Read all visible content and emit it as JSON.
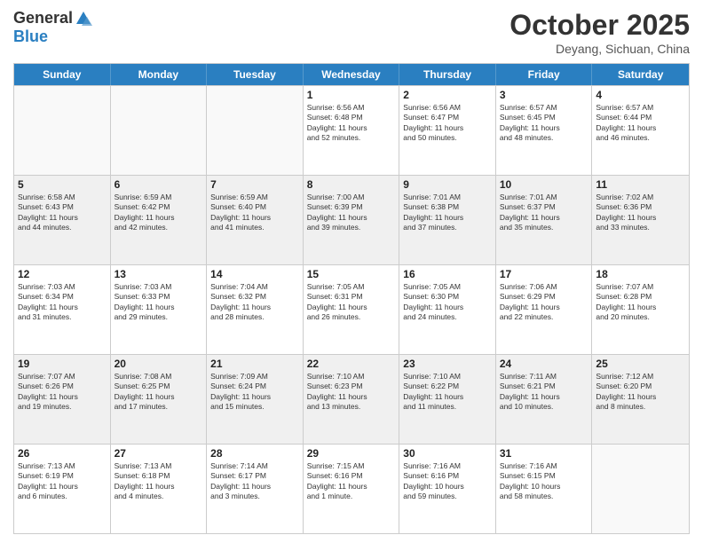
{
  "header": {
    "logo_general": "General",
    "logo_blue": "Blue",
    "month_title": "October 2025",
    "subtitle": "Deyang, Sichuan, China"
  },
  "days_of_week": [
    "Sunday",
    "Monday",
    "Tuesday",
    "Wednesday",
    "Thursday",
    "Friday",
    "Saturday"
  ],
  "weeks": [
    [
      {
        "day": "",
        "lines": []
      },
      {
        "day": "",
        "lines": []
      },
      {
        "day": "",
        "lines": []
      },
      {
        "day": "1",
        "lines": [
          "Sunrise: 6:56 AM",
          "Sunset: 6:48 PM",
          "Daylight: 11 hours",
          "and 52 minutes."
        ]
      },
      {
        "day": "2",
        "lines": [
          "Sunrise: 6:56 AM",
          "Sunset: 6:47 PM",
          "Daylight: 11 hours",
          "and 50 minutes."
        ]
      },
      {
        "day": "3",
        "lines": [
          "Sunrise: 6:57 AM",
          "Sunset: 6:45 PM",
          "Daylight: 11 hours",
          "and 48 minutes."
        ]
      },
      {
        "day": "4",
        "lines": [
          "Sunrise: 6:57 AM",
          "Sunset: 6:44 PM",
          "Daylight: 11 hours",
          "and 46 minutes."
        ]
      }
    ],
    [
      {
        "day": "5",
        "lines": [
          "Sunrise: 6:58 AM",
          "Sunset: 6:43 PM",
          "Daylight: 11 hours",
          "and 44 minutes."
        ]
      },
      {
        "day": "6",
        "lines": [
          "Sunrise: 6:59 AM",
          "Sunset: 6:42 PM",
          "Daylight: 11 hours",
          "and 42 minutes."
        ]
      },
      {
        "day": "7",
        "lines": [
          "Sunrise: 6:59 AM",
          "Sunset: 6:40 PM",
          "Daylight: 11 hours",
          "and 41 minutes."
        ]
      },
      {
        "day": "8",
        "lines": [
          "Sunrise: 7:00 AM",
          "Sunset: 6:39 PM",
          "Daylight: 11 hours",
          "and 39 minutes."
        ]
      },
      {
        "day": "9",
        "lines": [
          "Sunrise: 7:01 AM",
          "Sunset: 6:38 PM",
          "Daylight: 11 hours",
          "and 37 minutes."
        ]
      },
      {
        "day": "10",
        "lines": [
          "Sunrise: 7:01 AM",
          "Sunset: 6:37 PM",
          "Daylight: 11 hours",
          "and 35 minutes."
        ]
      },
      {
        "day": "11",
        "lines": [
          "Sunrise: 7:02 AM",
          "Sunset: 6:36 PM",
          "Daylight: 11 hours",
          "and 33 minutes."
        ]
      }
    ],
    [
      {
        "day": "12",
        "lines": [
          "Sunrise: 7:03 AM",
          "Sunset: 6:34 PM",
          "Daylight: 11 hours",
          "and 31 minutes."
        ]
      },
      {
        "day": "13",
        "lines": [
          "Sunrise: 7:03 AM",
          "Sunset: 6:33 PM",
          "Daylight: 11 hours",
          "and 29 minutes."
        ]
      },
      {
        "day": "14",
        "lines": [
          "Sunrise: 7:04 AM",
          "Sunset: 6:32 PM",
          "Daylight: 11 hours",
          "and 28 minutes."
        ]
      },
      {
        "day": "15",
        "lines": [
          "Sunrise: 7:05 AM",
          "Sunset: 6:31 PM",
          "Daylight: 11 hours",
          "and 26 minutes."
        ]
      },
      {
        "day": "16",
        "lines": [
          "Sunrise: 7:05 AM",
          "Sunset: 6:30 PM",
          "Daylight: 11 hours",
          "and 24 minutes."
        ]
      },
      {
        "day": "17",
        "lines": [
          "Sunrise: 7:06 AM",
          "Sunset: 6:29 PM",
          "Daylight: 11 hours",
          "and 22 minutes."
        ]
      },
      {
        "day": "18",
        "lines": [
          "Sunrise: 7:07 AM",
          "Sunset: 6:28 PM",
          "Daylight: 11 hours",
          "and 20 minutes."
        ]
      }
    ],
    [
      {
        "day": "19",
        "lines": [
          "Sunrise: 7:07 AM",
          "Sunset: 6:26 PM",
          "Daylight: 11 hours",
          "and 19 minutes."
        ]
      },
      {
        "day": "20",
        "lines": [
          "Sunrise: 7:08 AM",
          "Sunset: 6:25 PM",
          "Daylight: 11 hours",
          "and 17 minutes."
        ]
      },
      {
        "day": "21",
        "lines": [
          "Sunrise: 7:09 AM",
          "Sunset: 6:24 PM",
          "Daylight: 11 hours",
          "and 15 minutes."
        ]
      },
      {
        "day": "22",
        "lines": [
          "Sunrise: 7:10 AM",
          "Sunset: 6:23 PM",
          "Daylight: 11 hours",
          "and 13 minutes."
        ]
      },
      {
        "day": "23",
        "lines": [
          "Sunrise: 7:10 AM",
          "Sunset: 6:22 PM",
          "Daylight: 11 hours",
          "and 11 minutes."
        ]
      },
      {
        "day": "24",
        "lines": [
          "Sunrise: 7:11 AM",
          "Sunset: 6:21 PM",
          "Daylight: 11 hours",
          "and 10 minutes."
        ]
      },
      {
        "day": "25",
        "lines": [
          "Sunrise: 7:12 AM",
          "Sunset: 6:20 PM",
          "Daylight: 11 hours",
          "and 8 minutes."
        ]
      }
    ],
    [
      {
        "day": "26",
        "lines": [
          "Sunrise: 7:13 AM",
          "Sunset: 6:19 PM",
          "Daylight: 11 hours",
          "and 6 minutes."
        ]
      },
      {
        "day": "27",
        "lines": [
          "Sunrise: 7:13 AM",
          "Sunset: 6:18 PM",
          "Daylight: 11 hours",
          "and 4 minutes."
        ]
      },
      {
        "day": "28",
        "lines": [
          "Sunrise: 7:14 AM",
          "Sunset: 6:17 PM",
          "Daylight: 11 hours",
          "and 3 minutes."
        ]
      },
      {
        "day": "29",
        "lines": [
          "Sunrise: 7:15 AM",
          "Sunset: 6:16 PM",
          "Daylight: 11 hours",
          "and 1 minute."
        ]
      },
      {
        "day": "30",
        "lines": [
          "Sunrise: 7:16 AM",
          "Sunset: 6:16 PM",
          "Daylight: 10 hours",
          "and 59 minutes."
        ]
      },
      {
        "day": "31",
        "lines": [
          "Sunrise: 7:16 AM",
          "Sunset: 6:15 PM",
          "Daylight: 10 hours",
          "and 58 minutes."
        ]
      },
      {
        "day": "",
        "lines": []
      }
    ]
  ]
}
